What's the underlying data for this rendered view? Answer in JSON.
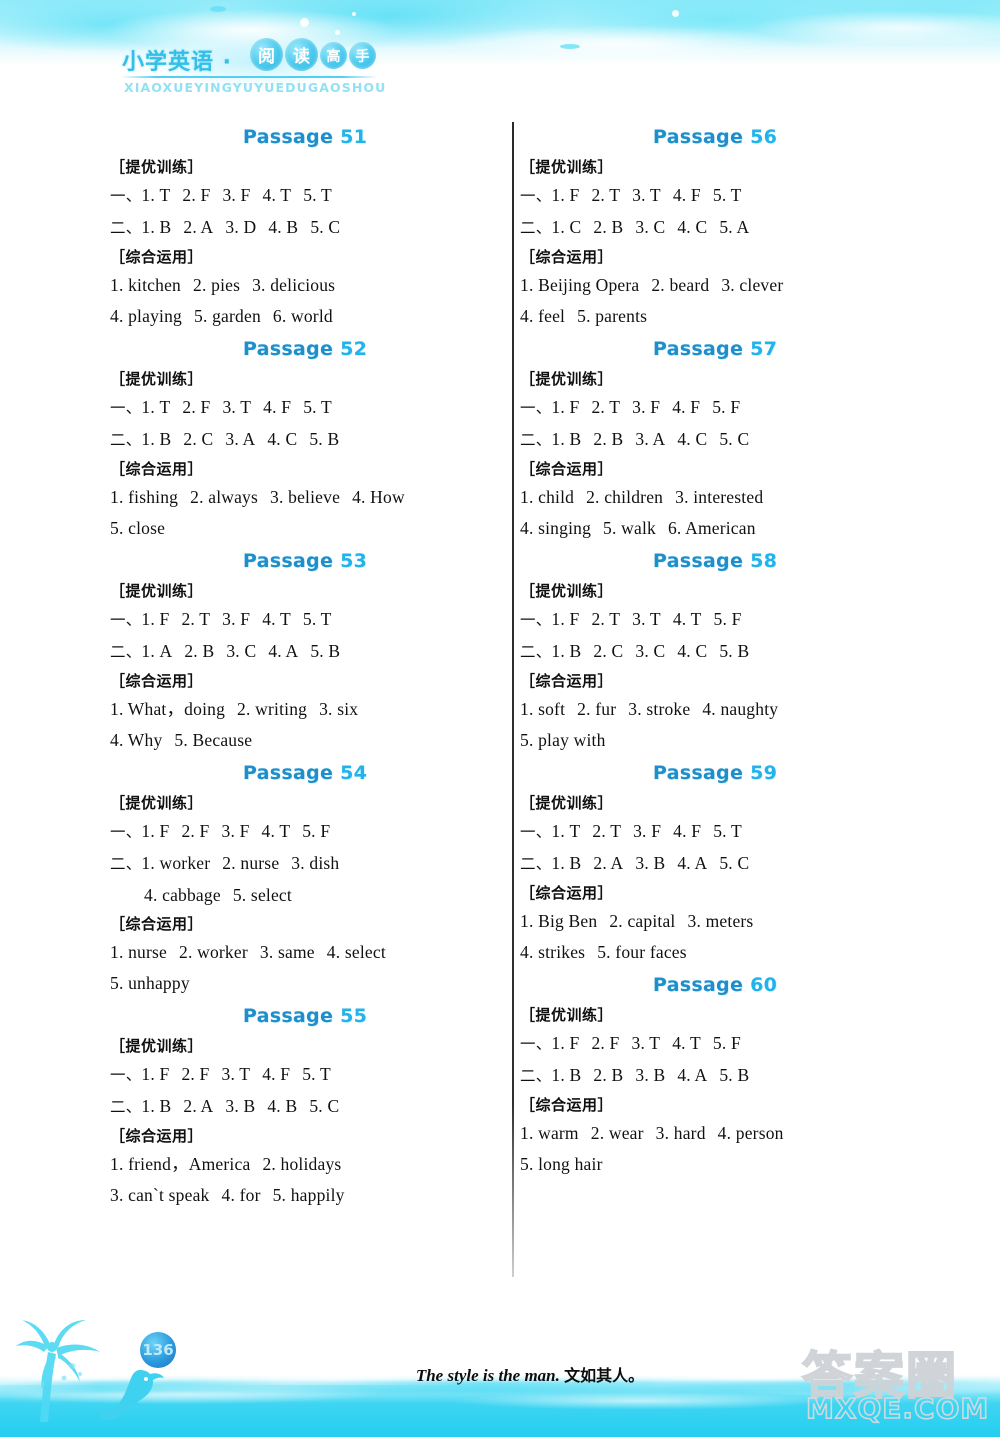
{
  "header": {
    "title_cn": "小学英语 ·",
    "bubbles": [
      "阅",
      "读",
      "高",
      "手"
    ],
    "pinyin": "XIAOXUEYINGYUYUEDUGAOSHOU"
  },
  "labels": {
    "section_training": "［提优训练］",
    "section_comprehensive": "［综合运用］",
    "passage_word": "Passage"
  },
  "columns": {
    "left": [
      {
        "number": "51",
        "training": [
          {
            "lead": "一、",
            "items": [
              "1. T",
              "2. F",
              "3. F",
              "4. T",
              "5. T"
            ]
          },
          {
            "lead": "二、",
            "items": [
              "1. B",
              "2. A",
              "3. D",
              "4. B",
              "5. C"
            ]
          }
        ],
        "comprehensive": [
          {
            "lead": "",
            "items": [
              "1. kitchen",
              "2. pies",
              "3. delicious"
            ]
          },
          {
            "lead": "",
            "items": [
              "4. playing",
              "5. garden",
              "6. world"
            ]
          }
        ]
      },
      {
        "number": "52",
        "training": [
          {
            "lead": "一、",
            "items": [
              "1. T",
              "2. F",
              "3. T",
              "4. F",
              "5. T"
            ]
          },
          {
            "lead": "二、",
            "items": [
              "1. B",
              "2. C",
              "3. A",
              "4. C",
              "5. B"
            ]
          }
        ],
        "comprehensive": [
          {
            "lead": "",
            "items": [
              "1. fishing",
              "2. always",
              "3. believe",
              "4. How"
            ]
          },
          {
            "lead": "",
            "items": [
              "5. close"
            ]
          }
        ]
      },
      {
        "number": "53",
        "training": [
          {
            "lead": "一、",
            "items": [
              "1. F",
              "2. T",
              "3. F",
              "4. T",
              "5. T"
            ]
          },
          {
            "lead": "二、",
            "items": [
              "1. A",
              "2. B",
              "3. C",
              "4. A",
              "5. B"
            ]
          }
        ],
        "comprehensive": [
          {
            "lead": "",
            "items": [
              "1. What，doing",
              "2. writing",
              "3. six"
            ]
          },
          {
            "lead": "",
            "items": [
              "4. Why",
              "5. Because"
            ]
          }
        ]
      },
      {
        "number": "54",
        "training": [
          {
            "lead": "一、",
            "items": [
              "1. F",
              "2. F",
              "3. F",
              "4. T",
              "5. F"
            ]
          },
          {
            "lead": "二、",
            "items": [
              "1. worker",
              "2. nurse",
              "3. dish"
            ]
          },
          {
            "lead": "",
            "items": [
              "4. cabbage",
              "5. select"
            ],
            "indent": true
          }
        ],
        "comprehensive": [
          {
            "lead": "",
            "items": [
              "1. nurse",
              "2. worker",
              "3. same",
              "4. select"
            ]
          },
          {
            "lead": "",
            "items": [
              "5. unhappy"
            ]
          }
        ]
      },
      {
        "number": "55",
        "training": [
          {
            "lead": "一、",
            "items": [
              "1. F",
              "2. F",
              "3. T",
              "4. F",
              "5. T"
            ]
          },
          {
            "lead": "二、",
            "items": [
              "1. B",
              "2. A",
              "3. B",
              "4. B",
              "5. C"
            ]
          }
        ],
        "comprehensive": [
          {
            "lead": "",
            "items": [
              "1. friend，America",
              "2. holidays"
            ]
          },
          {
            "lead": "",
            "items": [
              "3. can`t speak",
              "4. for",
              "5. happily"
            ]
          }
        ]
      }
    ],
    "right": [
      {
        "number": "56",
        "training": [
          {
            "lead": "一、",
            "items": [
              "1. F",
              "2. T",
              "3. T",
              "4. F",
              "5. T"
            ]
          },
          {
            "lead": "二、",
            "items": [
              "1. C",
              "2. B",
              "3. C",
              "4. C",
              "5. A"
            ]
          }
        ],
        "comprehensive": [
          {
            "lead": "",
            "items": [
              "1. Beijing Opera",
              "2. beard",
              "3. clever"
            ]
          },
          {
            "lead": "",
            "items": [
              "4. feel",
              "5. parents"
            ]
          }
        ]
      },
      {
        "number": "57",
        "training": [
          {
            "lead": "一、",
            "items": [
              "1. F",
              "2. T",
              "3. F",
              "4. F",
              "5. F"
            ]
          },
          {
            "lead": "二、",
            "items": [
              "1. B",
              "2. B",
              "3. A",
              "4. C",
              "5. C"
            ]
          }
        ],
        "comprehensive": [
          {
            "lead": "",
            "items": [
              "1. child",
              "2. children",
              "3. interested"
            ]
          },
          {
            "lead": "",
            "items": [
              "4. singing",
              "5. walk",
              "6. American"
            ]
          }
        ]
      },
      {
        "number": "58",
        "training": [
          {
            "lead": "一、",
            "items": [
              "1. F",
              "2. T",
              "3. T",
              "4. T",
              "5. F"
            ]
          },
          {
            "lead": "二、",
            "items": [
              "1. B",
              "2. C",
              "3. C",
              "4. C",
              "5. B"
            ]
          }
        ],
        "comprehensive": [
          {
            "lead": "",
            "items": [
              "1. soft",
              "2. fur",
              "3. stroke",
              "4. naughty"
            ]
          },
          {
            "lead": "",
            "items": [
              "5. play with"
            ]
          }
        ]
      },
      {
        "number": "59",
        "training": [
          {
            "lead": "一、",
            "items": [
              "1. T",
              "2. T",
              "3. F",
              "4. F",
              "5. T"
            ]
          },
          {
            "lead": "二、",
            "items": [
              "1. B",
              "2. A",
              "3. B",
              "4. A",
              "5. C"
            ]
          }
        ],
        "comprehensive": [
          {
            "lead": "",
            "items": [
              "1. Big Ben",
              "2. capital",
              "3. meters"
            ]
          },
          {
            "lead": "",
            "items": [
              "4. strikes",
              "5. four faces"
            ]
          }
        ]
      },
      {
        "number": "60",
        "training": [
          {
            "lead": "一、",
            "items": [
              "1. F",
              "2. F",
              "3. T",
              "4. T",
              "5. F"
            ]
          },
          {
            "lead": "二、",
            "items": [
              "1. B",
              "2. B",
              "3. B",
              "4. A",
              "5. B"
            ]
          }
        ],
        "comprehensive": [
          {
            "lead": "",
            "items": [
              "1. warm",
              "2. wear",
              "3. hard",
              "4. person"
            ]
          },
          {
            "lead": "",
            "items": [
              "5. long hair"
            ]
          }
        ]
      }
    ]
  },
  "footer": {
    "page_number": "136",
    "quote_en": "The style is the man",
    "quote_sep": ".",
    "quote_cn": "文如其人。"
  },
  "watermark": {
    "cn": "答案圈",
    "en": "MXQE.COM"
  },
  "colors": {
    "accent_blue": "#22b3ec",
    "title_blue": "#1f8fcc",
    "sea_cyan": "#3fd5f2",
    "ink": "#111111"
  }
}
